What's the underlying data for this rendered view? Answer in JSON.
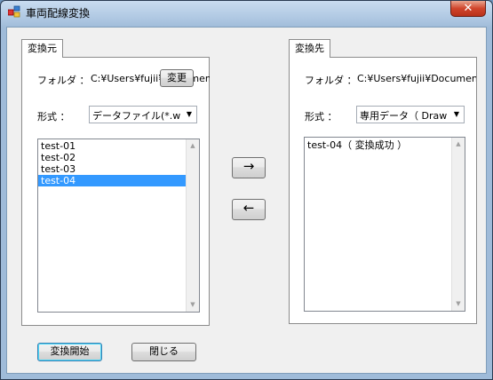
{
  "window": {
    "title": "車両配線変換",
    "close_glyph": "✕"
  },
  "source": {
    "tab_label": "変換元",
    "folder_label": "フォルダ ：",
    "folder_path": "C:¥Users¥fujii¥Documents",
    "change_button": "変更",
    "format_label": "形式 ：",
    "format_value": "データファイル(*.wdsc",
    "files": [
      "test-01",
      "test-02",
      "test-03",
      "test-04"
    ],
    "selected_index": 3
  },
  "destination": {
    "tab_label": "変換先",
    "folder_label": "フォルダ ：",
    "folder_path": "C:¥Users¥fujii¥Documents",
    "format_label": "形式 ：",
    "format_value": "専用データ（ Draw ）",
    "files": [
      "test-04（ 変換成功 ）"
    ]
  },
  "transfer": {
    "right_arrow": "→",
    "left_arrow": "←"
  },
  "footer": {
    "start_button": "変換開始",
    "close_button": "閉じる"
  },
  "icons": {
    "combo_arrow": "▼",
    "scroll_up": "▲",
    "scroll_down": "▼"
  }
}
